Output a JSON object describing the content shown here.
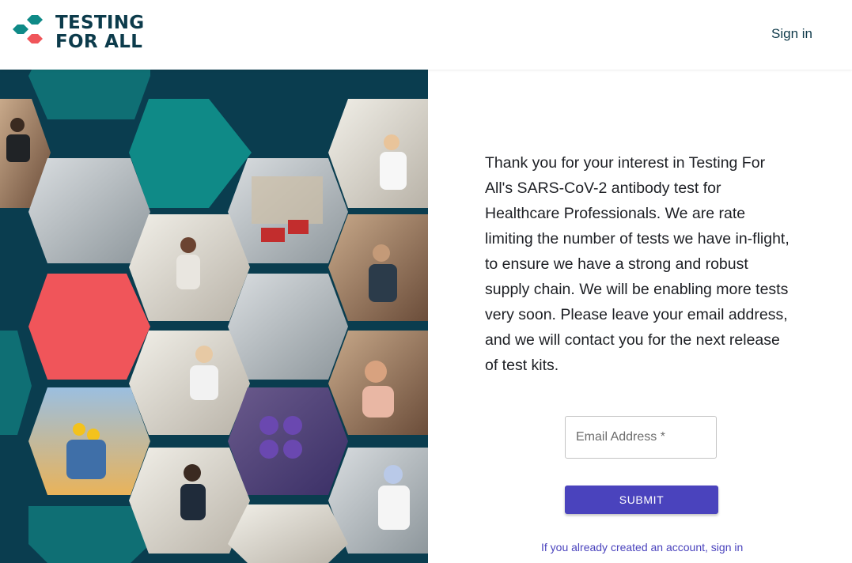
{
  "header": {
    "logo_line1": "TESTING",
    "logo_line2": "FOR ALL",
    "signin_label": "Sign in"
  },
  "collage": {
    "image_description_names": [
      "people-photo-hexagon",
      "lab-photo-hexagon",
      "street-photo-hexagon"
    ]
  },
  "main": {
    "message": "Thank you for your interest in Testing For All's SARS-CoV-2 antibody test for Healthcare Professionals. We are rate limiting the number of tests we have in-flight, to ensure we have a strong and robust supply chain. We will be enabling more tests very soon. Please leave your email address, and we will contact you for the next release of test kits.",
    "email_label": "Email Address",
    "email_required_mark": "*",
    "submit_label": "SUBMIT",
    "signin_hint": "If you already created an account, sign in"
  },
  "colors": {
    "brand_teal": "#0f8a87",
    "brand_red": "#f0555a",
    "dark_teal": "#0a3d4f",
    "button": "#4a43bd"
  }
}
